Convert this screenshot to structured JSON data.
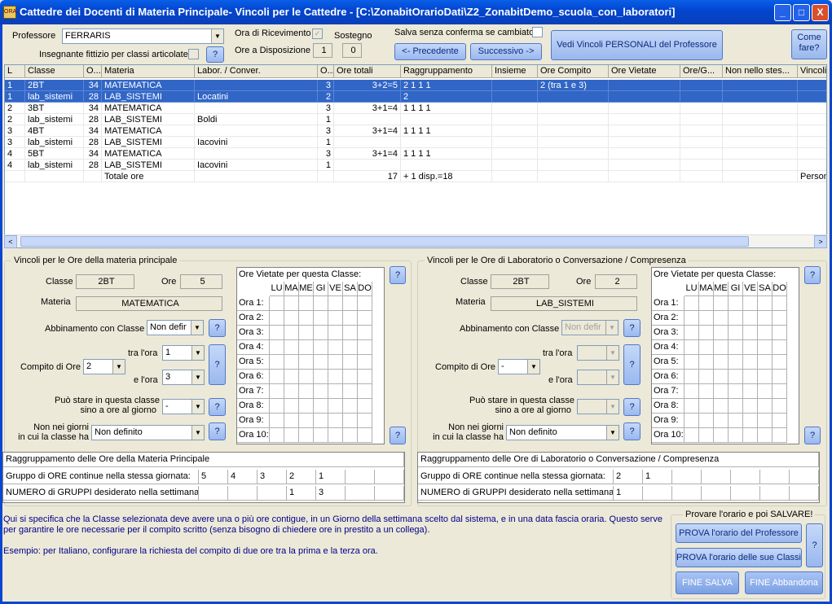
{
  "window": {
    "title": "Cattedre dei Docenti di Materia Principale- Vincoli per le Cattedre  -  [C:\\ZonabitOrarioDati\\Z2_ZonabitDemo_scuola_con_laboratori]",
    "minimize": "_",
    "maximize": "□",
    "close": "X",
    "app_icon_text": "ORA"
  },
  "top": {
    "professore_label": "Professore",
    "professore_value": "FERRARIS",
    "fittizio_label": "Insegnante fittizio per classi articolate",
    "help": "?",
    "ricevimento_label": "Ora di Ricevimento",
    "disposizione_label": "Ore a Disposizione",
    "disposizione_value": "1",
    "sostegno_label": "Sostegno",
    "sostegno_value": "0",
    "salva_label": "Salva senza conferma se cambiato",
    "precedente": "<- Precedente",
    "successivo": "Successivo ->",
    "vedi_vincoli": "Vedi Vincoli PERSONALI del Professore",
    "come_fare": "Come fare?"
  },
  "grid": {
    "columns": [
      "L",
      "Classe",
      "O...",
      "Materia",
      "Labor. / Conver.",
      "O...",
      "Ore totali",
      "Raggruppamento",
      "Insieme",
      "Ore Compito",
      "Ore Vietate",
      "Ore/G...",
      "Non nello stes...",
      "Vincoli Pro"
    ],
    "rows": [
      [
        "1",
        "2BT",
        "34",
        "MATEMATICA",
        "",
        "3",
        "3+2=5",
        "2 1 1 1",
        "",
        "2 (tra 1 e 3)",
        "",
        "",
        "",
        ""
      ],
      [
        "1",
        "lab_sistemi",
        "28",
        "LAB_SISTEMI",
        "Locatini",
        "2",
        "",
        "2",
        "",
        "",
        "",
        "",
        "",
        ""
      ],
      [
        "2",
        "3BT",
        "34",
        "MATEMATICA",
        "",
        "3",
        "3+1=4",
        "1 1 1 1",
        "",
        "",
        "",
        "",
        "",
        ""
      ],
      [
        "2",
        "lab_sistemi",
        "28",
        "LAB_SISTEMI",
        "Boldi",
        "1",
        "",
        "",
        "",
        "",
        "",
        "",
        "",
        ""
      ],
      [
        "3",
        "4BT",
        "34",
        "MATEMATICA",
        "",
        "3",
        "3+1=4",
        "1 1 1 1",
        "",
        "",
        "",
        "",
        "",
        ""
      ],
      [
        "3",
        "lab_sistemi",
        "28",
        "LAB_SISTEMI",
        "Iacovini",
        "1",
        "",
        "",
        "",
        "",
        "",
        "",
        "",
        ""
      ],
      [
        "4",
        "5BT",
        "34",
        "MATEMATICA",
        "",
        "3",
        "3+1=4",
        "1 1 1 1",
        "",
        "",
        "",
        "",
        "",
        ""
      ],
      [
        "4",
        "lab_sistemi",
        "28",
        "LAB_SISTEMI",
        "Iacovini",
        "1",
        "",
        "",
        "",
        "",
        "",
        "",
        "",
        ""
      ],
      [
        "",
        "",
        "",
        "Totale ore",
        "",
        "",
        "17",
        "+ 1 disp.=18",
        "",
        "",
        "",
        "",
        "",
        "Personali"
      ]
    ],
    "scroll_left": "<",
    "scroll_right": ">"
  },
  "left": {
    "title": "Vincoli per le Ore della materia principale",
    "classe_label": "Classe",
    "classe_value": "2BT",
    "ore_label": "Ore",
    "ore_value": "5",
    "materia_label": "Materia",
    "materia_value": "MATEMATICA",
    "abbinamento_label": "Abbinamento con Classe",
    "abbinamento_value": "Non defir",
    "compito_label": "Compito di Ore",
    "compito_value": "2",
    "tra_label": "tra l'ora",
    "tra_value": "1",
    "e_label": "e l'ora",
    "e_value": "3",
    "stare_label1": "Può stare in questa classe",
    "stare_label2": "sino a ore al giorno",
    "stare_value": "-",
    "nonnei_label1": "Non nei giorni",
    "nonnei_label2": "in cui la classe ha",
    "nonnei_value": "Non definito",
    "vietate_title": "Ore Vietate per questa Classe:",
    "rag_title": "Raggruppamento delle Ore della Materia Principale",
    "gruppo_label": "Gruppo di ORE continue nella stessa giornata:",
    "gruppo_values": [
      "5",
      "4",
      "3",
      "2",
      "1",
      "",
      ""
    ],
    "numero_label": "NUMERO di GRUPPI desiderato nella settimana:",
    "numero_values": [
      "",
      "",
      "",
      "1",
      "3",
      "",
      ""
    ]
  },
  "right": {
    "title": "Vincoli per le Ore di Laboratorio o Conversazione / Compresenza",
    "classe_label": "Classe",
    "classe_value": "2BT",
    "ore_label": "Ore",
    "ore_value": "2",
    "materia_label": "Materia",
    "materia_value": "LAB_SISTEMI",
    "abbinamento_label": "Abbinamento con Classe",
    "abbinamento_value": "Non defir",
    "compito_label": "Compito di Ore",
    "compito_value": "-",
    "tra_label": "tra l'ora",
    "tra_value": "",
    "e_label": "e l'ora",
    "e_value": "",
    "stare_label1": "Può stare in questa classe",
    "stare_label2": "sino a ore al giorno",
    "stare_value": "",
    "nonnei_label1": "Non nei giorni",
    "nonnei_label2": "in cui la classe ha",
    "nonnei_value": "Non definito",
    "vietate_title": "Ore Vietate per questa Classe:",
    "rag_title": "Raggruppamento delle Ore di Laboratorio o Conversazione / Compresenza",
    "gruppo_label": "Gruppo di ORE continue nella stessa giornata:",
    "gruppo_values": [
      "2",
      "1",
      "",
      "",
      "",
      "",
      ""
    ],
    "numero_label": "NUMERO di GRUPPI desiderato nella settimana:",
    "numero_values": [
      "1",
      "",
      "",
      "",
      "",
      "",
      ""
    ]
  },
  "days": [
    "LU",
    "MA",
    "ME",
    "GI",
    "VE",
    "SA",
    "DO"
  ],
  "hours": [
    "Ora 1:",
    "Ora 2:",
    "Ora 3:",
    "Ora 4:",
    "Ora 5:",
    "Ora 6:",
    "Ora 7:",
    "Ora 8:",
    "Ora 9:",
    "Ora 10:"
  ],
  "info": {
    "line1": "Qui si specifica che la Classe selezionata deve avere una o più ore contigue, in un Giorno della settimana scelto dal sistema, e in una data fascia oraria. Questo serve per garantire le ore necessarie per il compito scritto (senza bisogno di chiedere ore in prestito a un collega).",
    "line2": "Esempio: per Italiano, configurare la richiesta del compito di due ore tra la prima e la terza ora."
  },
  "prova": {
    "title": "Provare  l'orario e poi SALVARE!",
    "prof": "PROVA l'orario del Professore",
    "classi": "PROVA l'orario delle sue Classi",
    "fine_salva": "FINE SALVA",
    "fine_abbandona": "FINE Abbandona",
    "help": "?"
  }
}
